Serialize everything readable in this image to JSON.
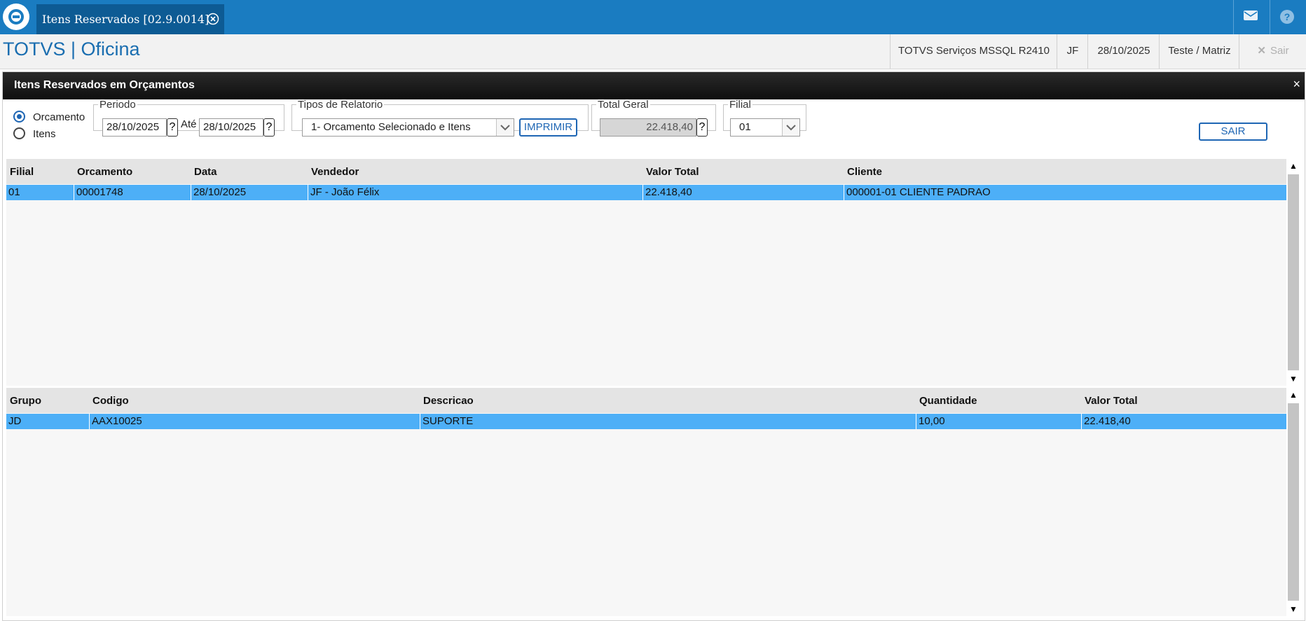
{
  "topbar": {
    "tab_label": "Itens Reservados [02.9.0014]",
    "mail_icon": "mail-icon",
    "help_icon": "help-icon"
  },
  "header": {
    "brand": "TOTVS | Oficina",
    "server": "TOTVS Serviços MSSQL R2410",
    "user": "JF",
    "date": "28/10/2025",
    "company": "Teste / Matriz",
    "exit": "Sair"
  },
  "dialog": {
    "title": "Itens Reservados em Orçamentos",
    "close": "×",
    "radio_orcamento": "Orcamento",
    "radio_itens": "Itens",
    "radio_selected": "Orcamento",
    "periodo_legend": "Periodo",
    "date_from": "28/10/2025",
    "ate_label": "Até",
    "date_to": "28/10/2025",
    "help_glyph": "?",
    "tipos_legend": "Tipos de Relatorio",
    "tipo_selected": "1- Orcamento Selecionado e Itens",
    "imprimir": "IMPRIMIR",
    "total_legend": "Total Geral",
    "total_value": "22.418,40",
    "filial_legend": "Filial",
    "filial_selected": "01",
    "sair": "SAIR"
  },
  "grid_orcamentos": {
    "headers": [
      "Filial",
      "Orcamento",
      "Data",
      "Vendedor",
      "Valor Total",
      "Cliente"
    ],
    "rows": [
      [
        "01",
        "00001748",
        "28/10/2025",
        "JF - João Félix",
        "22.418,40",
        "000001-01 CLIENTE PADRAO"
      ]
    ]
  },
  "grid_itens": {
    "headers": [
      "Grupo",
      "Codigo",
      "Descricao",
      "Quantidade",
      "Valor Total"
    ],
    "rows": [
      [
        "JD",
        "AAX10025",
        "SUPORTE",
        "10,00",
        "22.418,40"
      ]
    ]
  },
  "scroll": {
    "up": "▲",
    "down": "▼"
  }
}
